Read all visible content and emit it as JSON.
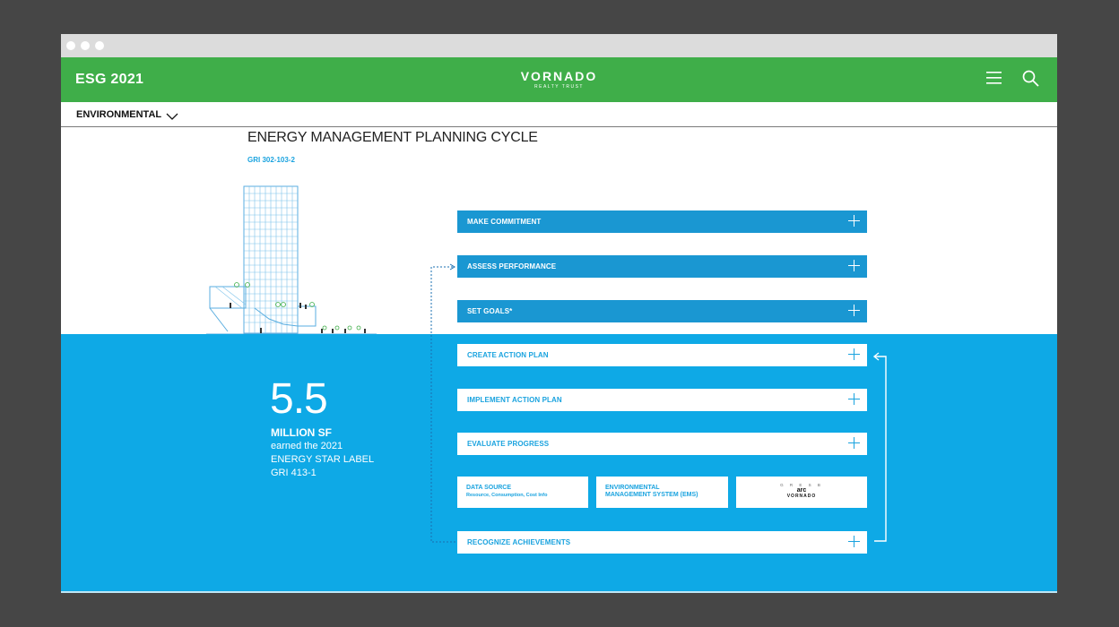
{
  "header": {
    "title": "ESG 2021",
    "logo_main": "VORNADO",
    "logo_sub": "REALTY TRUST",
    "menu_icon": "hamburger-menu-icon",
    "search_icon": "search-icon"
  },
  "subnav": {
    "section_label": "ENVIRONMENTAL",
    "chevron_icon": "chevron-down-icon"
  },
  "content": {
    "title": "ENERGY MANAGEMENT PLANNING CYCLE",
    "gri_code": "GRI 302-103-2"
  },
  "stat": {
    "number": "5.5",
    "unit": "MILLION SF",
    "line1": "earned the 2021",
    "line2": "ENERGY STAR LABEL",
    "line3": "GRI 413-1"
  },
  "steps": [
    {
      "label": "MAKE COMMITMENT"
    },
    {
      "label": "ASSESS PERFORMANCE"
    },
    {
      "label": "SET GOALS*"
    },
    {
      "label": "CREATE ACTION PLAN"
    },
    {
      "label": "IMPLEMENT ACTION PLAN"
    },
    {
      "label": "EVALUATE PROGRESS"
    },
    {
      "label": "RECOGNIZE ACHIEVEMENTS"
    }
  ],
  "sub_boxes": {
    "data_source_title": "DATA SOURCE",
    "data_source_detail": "Resource, Consumption, Cost Info",
    "ems_line1": "ENVIRONMENTAL",
    "ems_line2": "MANAGEMENT SYSTEM (EMS)",
    "gresb_top": "G R E S B",
    "gresb_arc": "arc",
    "gresb_vornado": "VORNADO"
  },
  "colors": {
    "brand_green": "#3fae49",
    "step_blue": "#1a97d2",
    "area_blue": "#0ea9e6",
    "accent_blue": "#1aa3df"
  }
}
